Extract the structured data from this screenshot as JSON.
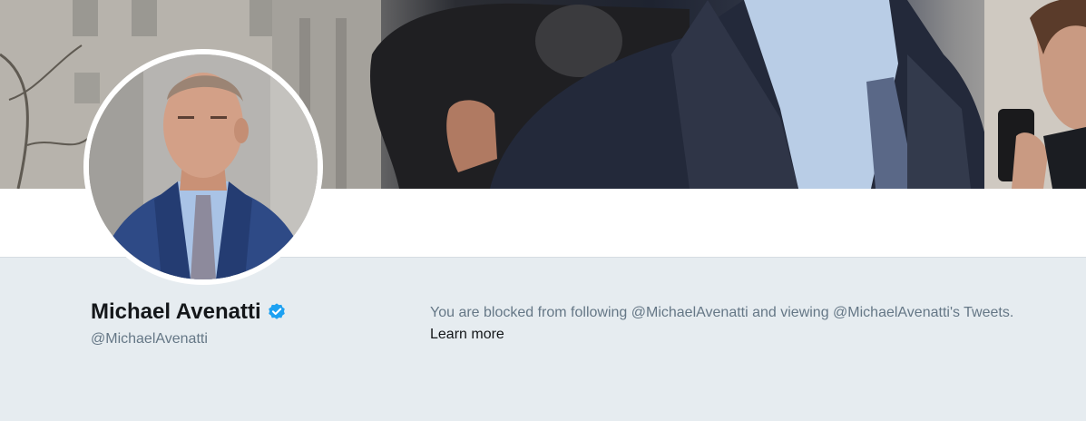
{
  "profile": {
    "name": "Michael Avenatti",
    "handle": "@MichaelAvenatti",
    "verified": true
  },
  "blocked_notice": {
    "message": "You are blocked from following @MichaelAvenatti and viewing @MichaelAvenatti's Tweets.",
    "learn_more_label": "Learn more"
  },
  "colors": {
    "page_background": "#e6ecf0",
    "verified_blue": "#1da1f2",
    "name_text": "#14171a",
    "secondary_text": "#657786"
  },
  "icons": {
    "verified": "verified-badge-icon"
  }
}
